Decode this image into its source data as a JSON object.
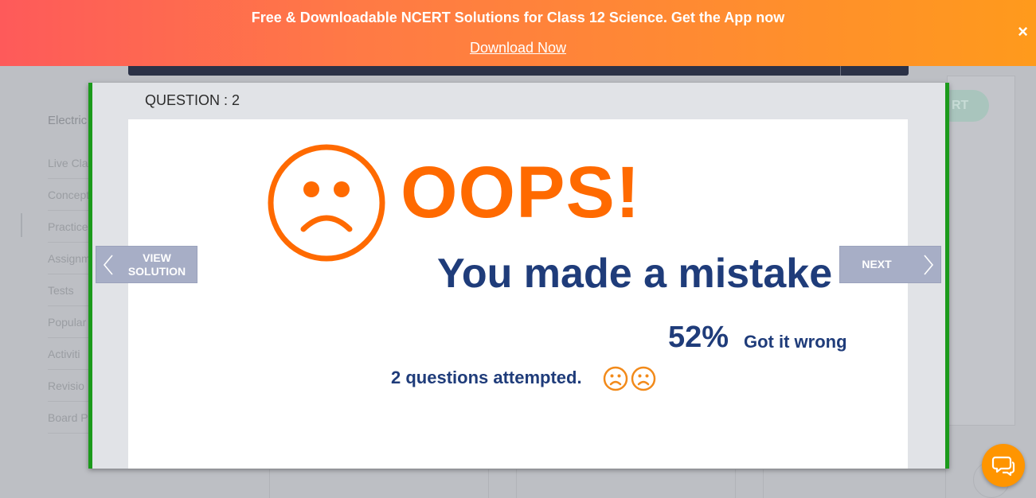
{
  "banner": {
    "text": "Free & Downloadable NCERT Solutions for Class 12 Science. Get the App now",
    "link_label": "Download Now",
    "close_glyph": "×"
  },
  "background": {
    "sidebar_title": "Electric",
    "sidebar_items": [
      "Live Cla",
      "Concept",
      "Practice",
      "Assignm",
      "Tests",
      "Popular",
      "Activiti",
      "Revisio",
      "Board P"
    ],
    "start_button_label": "RT"
  },
  "modal": {
    "question_label": "QUESTION : 2",
    "prev_button_label": "VIEW SOLUTION",
    "next_button_label": "NEXT",
    "oops_text": "OOPS!",
    "mistake_text": "You made a mistake",
    "percent_value": "52%",
    "percent_label": "Got it wrong",
    "attempted_text": "2 questions attempted."
  },
  "icons": {
    "sad_face": "sad-face-icon",
    "chevron_left": "chevron-left-icon",
    "chevron_right": "chevron-right-icon",
    "chat": "chat-icon",
    "close": "close-icon"
  },
  "colors": {
    "accent_orange": "#ff6a00",
    "text_navy": "#1f3c7a",
    "modal_border_green": "#1b9a1b",
    "nav_button": "#a7aec6",
    "chat_button": "#ff9500"
  }
}
